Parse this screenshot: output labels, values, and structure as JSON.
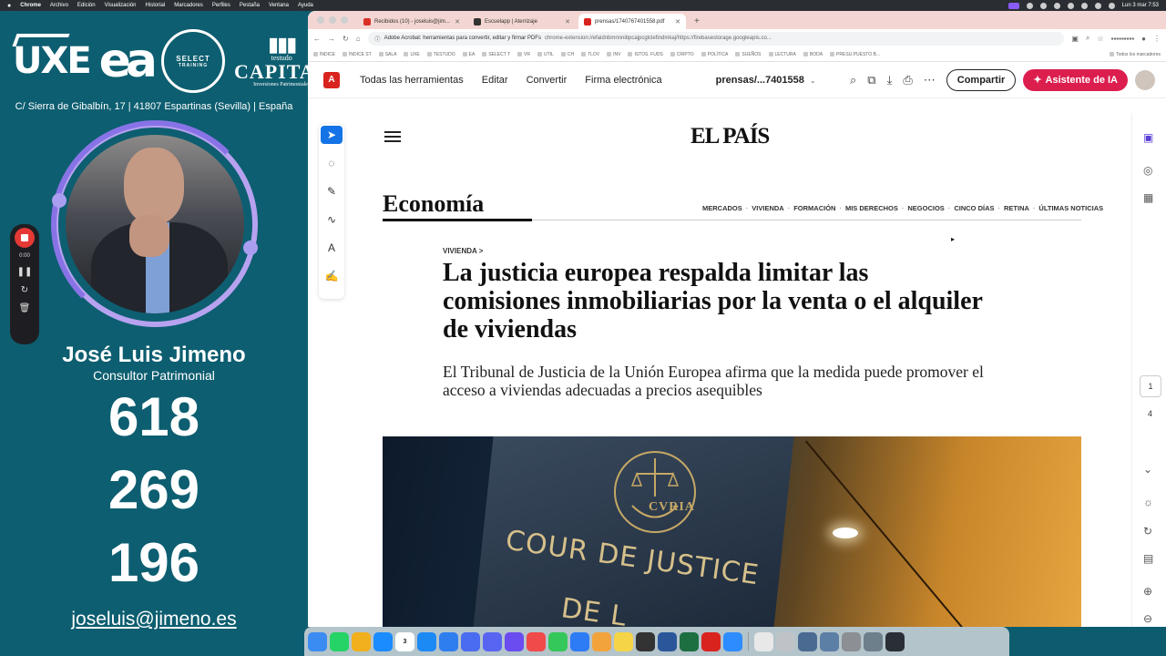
{
  "menubar": {
    "app": "Chrome",
    "items": [
      "Archivo",
      "Edición",
      "Visualización",
      "Historial",
      "Marcadores",
      "Perfiles",
      "Pestaña",
      "Ventana",
      "Ayuda"
    ],
    "clock": "Lun 3 mar 7:53"
  },
  "overlay": {
    "logos": {
      "uxe": "UXE",
      "ea": "ea",
      "select_main": "SELECT",
      "select_sub": "TRAINING",
      "capital_small": "testudo",
      "capital_main": "CAPITAL",
      "capital_sub": "Inversiones Patrimoniales"
    },
    "address": "C/ Sierra de Gibalbín, 17 | 41807 Espartinas (Sevilla) | España",
    "name": "José Luis Jimeno",
    "role": "Consultor Patrimonial",
    "phone": [
      "618",
      "269",
      "196"
    ],
    "email": "joseluis@jimeno.es",
    "recorder": {
      "time": "0:00",
      "pause": "❚❚",
      "restart": "↻",
      "delete": "🗑"
    }
  },
  "browser": {
    "tabs": [
      {
        "label": "Recibidos (10) - joseluis@jim...",
        "active": false,
        "color": "#d93025"
      },
      {
        "label": "Escuelapp | Aterrizaje",
        "active": false,
        "color": "#333333"
      },
      {
        "label": "prensas/1740767401558.pdf",
        "active": true,
        "color": "#d9231f"
      }
    ],
    "new_tab": "+",
    "url_title": "Adobe Acrobat: herramientas para convertir, editar y firmar PDFs",
    "url": "chrome-extension://efaidnbmnnnibpcajpcglclefindmkaj/https://firebasestorage.googleapis.co...",
    "bookmarks": [
      "ÍNDICE",
      "ÍNDICE ST",
      "SALA",
      "UXE",
      "TESTUDO",
      "EA",
      "SELECT T",
      "VR",
      "UTIL",
      "CH",
      "TLOV",
      "INV",
      "ISTOS. FUDS",
      "CRIPTO",
      "POLÍTICA",
      "SUEÑOS",
      "LECTURA",
      "BODA",
      "PRESU.PUESTO B..."
    ],
    "all_bookmarks": "Todos los marcadores"
  },
  "acrobat": {
    "logo": "A",
    "menu": [
      "Todas las herramientas",
      "Editar",
      "Convertir",
      "Firma electrónica"
    ],
    "filename": "prensas/...7401558",
    "share": "Compartir",
    "ai": "Asistente de IA",
    "page_current": "1",
    "page_total": "4"
  },
  "article": {
    "masthead": "EL PAÍS",
    "section": "Economía",
    "subnav": [
      "MERCADOS",
      "VIVIENDA",
      "FORMACIÓN",
      "MIS DERECHOS",
      "NEGOCIOS",
      "CINCO DÍAS",
      "RETINA",
      "ÚLTIMAS NOTICIAS"
    ],
    "kicker": "VIVIENDA >",
    "headline": "La justicia europea respalda limitar las comisiones inmobiliarias por la venta o el alquiler de viviendas",
    "subhead": "El Tribunal de Justicia de la Unión Europea afirma que la medida puede promover el acceso a viviendas adecuadas a precios asequibles",
    "photo_text": {
      "curia": "CVRIA",
      "line1": "COUR DE JUSTICE",
      "line2": "DE L"
    }
  },
  "dock": {
    "apps": [
      {
        "name": "finder",
        "color": "#3b8cf2"
      },
      {
        "name": "whatsapp",
        "color": "#25d366"
      },
      {
        "name": "chrome",
        "color": "#f2b01e"
      },
      {
        "name": "shazam",
        "color": "#1a8cff"
      },
      {
        "name": "calendar",
        "color": "#ffffff",
        "text": "3"
      },
      {
        "name": "appstore",
        "color": "#1c8af5"
      },
      {
        "name": "tasks",
        "color": "#2f7ef0"
      },
      {
        "name": "settings",
        "color": "#4a6cf0"
      },
      {
        "name": "discord",
        "color": "#5865f2"
      },
      {
        "name": "pencil",
        "color": "#6a4cf0"
      },
      {
        "name": "fantastical",
        "color": "#f04a4a"
      },
      {
        "name": "messages",
        "color": "#34c759"
      },
      {
        "name": "keynote",
        "color": "#2d7cf6"
      },
      {
        "name": "photos",
        "color": "#f2a33c"
      },
      {
        "name": "notes",
        "color": "#f5d547"
      },
      {
        "name": "chatgpt",
        "color": "#333333"
      },
      {
        "name": "word",
        "color": "#2b579a"
      },
      {
        "name": "excel",
        "color": "#1d6f42"
      },
      {
        "name": "acrobat",
        "color": "#d9231f"
      },
      {
        "name": "zoom",
        "color": "#2d8cff"
      },
      {
        "name": "preview",
        "color": "#e8e8e8"
      },
      {
        "name": "trash",
        "color": "#bfc3c8"
      },
      {
        "name": "window1",
        "color": "#4a6a92"
      },
      {
        "name": "window2",
        "color": "#5c7fa6"
      },
      {
        "name": "window3",
        "color": "#8c8f93"
      },
      {
        "name": "window4",
        "color": "#6e7f8c"
      },
      {
        "name": "window5",
        "color": "#2a2f35"
      }
    ]
  },
  "colors": {
    "teal": "#0d5e70",
    "acrobat_red": "#d9231f",
    "ai_button": "#dc1e4f",
    "select_blue": "#1473e6"
  }
}
